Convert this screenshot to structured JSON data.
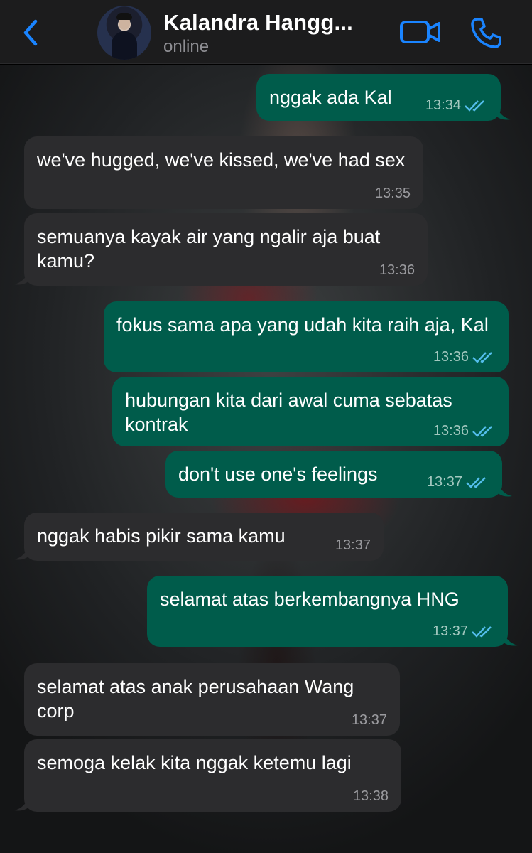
{
  "header": {
    "back_icon": "chevron-left-icon",
    "contact_name": "Kalandra Hangg...",
    "status": "online",
    "video_icon": "video-camera-icon",
    "call_icon": "phone-icon",
    "accent": "#1a84ff"
  },
  "messages": [
    {
      "dir": "out",
      "text": "nggak ada Kal",
      "time": "13:34",
      "read": true
    },
    {
      "dir": "in",
      "text": "we've hugged, we've kissed, we've had sex",
      "time": "13:35"
    },
    {
      "dir": "in",
      "text": "semuanya kayak air yang ngalir aja buat kamu?",
      "time": "13:36"
    },
    {
      "dir": "out",
      "text": "fokus sama apa yang udah kita raih aja, Kal",
      "time": "13:36",
      "read": true
    },
    {
      "dir": "out",
      "text": "hubungan kita dari awal cuma sebatas kontrak",
      "time": "13:36",
      "read": true
    },
    {
      "dir": "out",
      "text": "don't use one's feelings",
      "time": "13:37",
      "read": true
    },
    {
      "dir": "in",
      "text": "nggak habis pikir sama kamu",
      "time": "13:37"
    },
    {
      "dir": "out",
      "text": "selamat atas berkembangnya HNG",
      "time": "13:37",
      "read": true
    },
    {
      "dir": "in",
      "text": "selamat atas anak perusahaan Wang corp",
      "time": "13:37"
    },
    {
      "dir": "in",
      "text": "semoga kelak kita nggak ketemu lagi",
      "time": "13:38"
    }
  ],
  "colors": {
    "incoming_bubble": "#2c2c2e",
    "outgoing_bubble": "#005c4b",
    "read_tick": "#53bdeb"
  }
}
